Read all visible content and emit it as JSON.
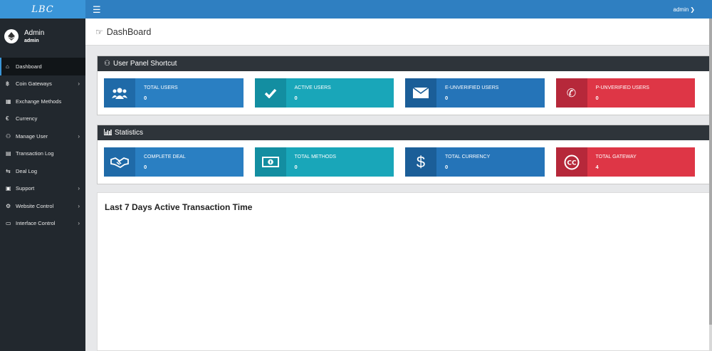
{
  "brand": {
    "logo": "LBC"
  },
  "topbar": {
    "menu_icon": "hamburger-icon",
    "user": "admin"
  },
  "sidebar": {
    "profile": {
      "name": "Admin",
      "role": "admin"
    },
    "items": [
      {
        "label": "Dashboard",
        "icon": "home-icon",
        "caret": false,
        "active": true
      },
      {
        "label": "Coin Gateways",
        "icon": "bitcoin-icon",
        "caret": true
      },
      {
        "label": "Exchange Methods",
        "icon": "exchange-icon",
        "caret": false
      },
      {
        "label": "Currency",
        "icon": "euro-icon",
        "caret": false
      },
      {
        "label": "Manage User",
        "icon": "users-icon",
        "caret": true
      },
      {
        "label": "Transaction Log",
        "icon": "log-icon",
        "caret": false
      },
      {
        "label": "Deal Log",
        "icon": "transfer-icon",
        "caret": false
      },
      {
        "label": "Support",
        "icon": "ticket-icon",
        "caret": true
      },
      {
        "label": "Website Control",
        "icon": "cogs-icon",
        "caret": true
      },
      {
        "label": "Interface Control",
        "icon": "desktop-icon",
        "caret": true
      }
    ]
  },
  "page": {
    "title": "DashBoard"
  },
  "shortcut_panel": {
    "title": "User Panel Shortcut",
    "cards": [
      {
        "label": "TOTAL USERS",
        "value": "0",
        "icon": "users-icon"
      },
      {
        "label": "ACTIVE USERS",
        "value": "0",
        "icon": "check-icon"
      },
      {
        "label": "E-UNVERIFIED USERS",
        "value": "0",
        "icon": "envelope-icon"
      },
      {
        "label": "P-UNVERIFIED USERS",
        "value": "0",
        "icon": "phone-icon"
      }
    ]
  },
  "statistics_panel": {
    "title": "Statistics",
    "cards": [
      {
        "label": "COMPLETE DEAL",
        "value": "0",
        "icon": "handshake-icon"
      },
      {
        "label": "TOTAL METHODS",
        "value": "0",
        "icon": "money-icon"
      },
      {
        "label": "TOTAL CURRENCY",
        "value": "0",
        "icon": "dollar-icon"
      },
      {
        "label": "TOTAL GATEWAY",
        "value": "4",
        "icon": "cc-icon"
      }
    ]
  },
  "chart_panel": {
    "title": "Last 7 Days Active Transaction Time"
  },
  "colors": {
    "topbar": "#2f7fc1",
    "logo_bar": "#3a95d8",
    "sidebar": "#22282e",
    "panel_header": "#2e343a",
    "blue": "#2a7fc2",
    "teal": "#19a6b9",
    "red": "#de3646"
  }
}
